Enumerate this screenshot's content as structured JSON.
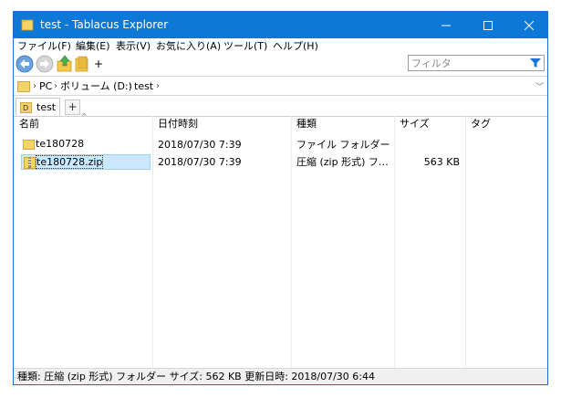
{
  "window": {
    "title": "test - Tablacus Explorer"
  },
  "menu": [
    {
      "label": "ファイル(F)"
    },
    {
      "label": "編集(E)"
    },
    {
      "label": "表示(V)"
    },
    {
      "label": "お気に入り(A)"
    },
    {
      "label": "ツール(T)"
    },
    {
      "label": "ヘルプ(H)"
    }
  ],
  "toolbar": {
    "add_label": "+",
    "filter_placeholder": "フィルタ"
  },
  "address": {
    "crumbs": [
      "PC",
      "ボリューム (D:)",
      "test"
    ]
  },
  "tabs": {
    "active": "test",
    "add": "+"
  },
  "columns": [
    "名前",
    "日付時刻",
    "種類",
    "サイズ",
    "タグ"
  ],
  "rows": [
    {
      "name": "te180728",
      "date": "2018/07/30 7:39",
      "type": "ファイル フォルダー",
      "size": "",
      "icon": "folder-icon"
    },
    {
      "name": "te180728.zip",
      "date": "2018/07/30 7:39",
      "type": "圧縮 (zip 形式) フ…",
      "size": "563 KB",
      "icon": "zip-folder-icon"
    }
  ],
  "status": {
    "text": "種類: 圧縮 (zip 形式) フォルダー サイズ: 562 KB 更新日時: 2018/07/30 6:44"
  },
  "colors": {
    "titlebar": "#0e78d6",
    "selection": "#cce8ff",
    "folder": "#f5c84c"
  }
}
